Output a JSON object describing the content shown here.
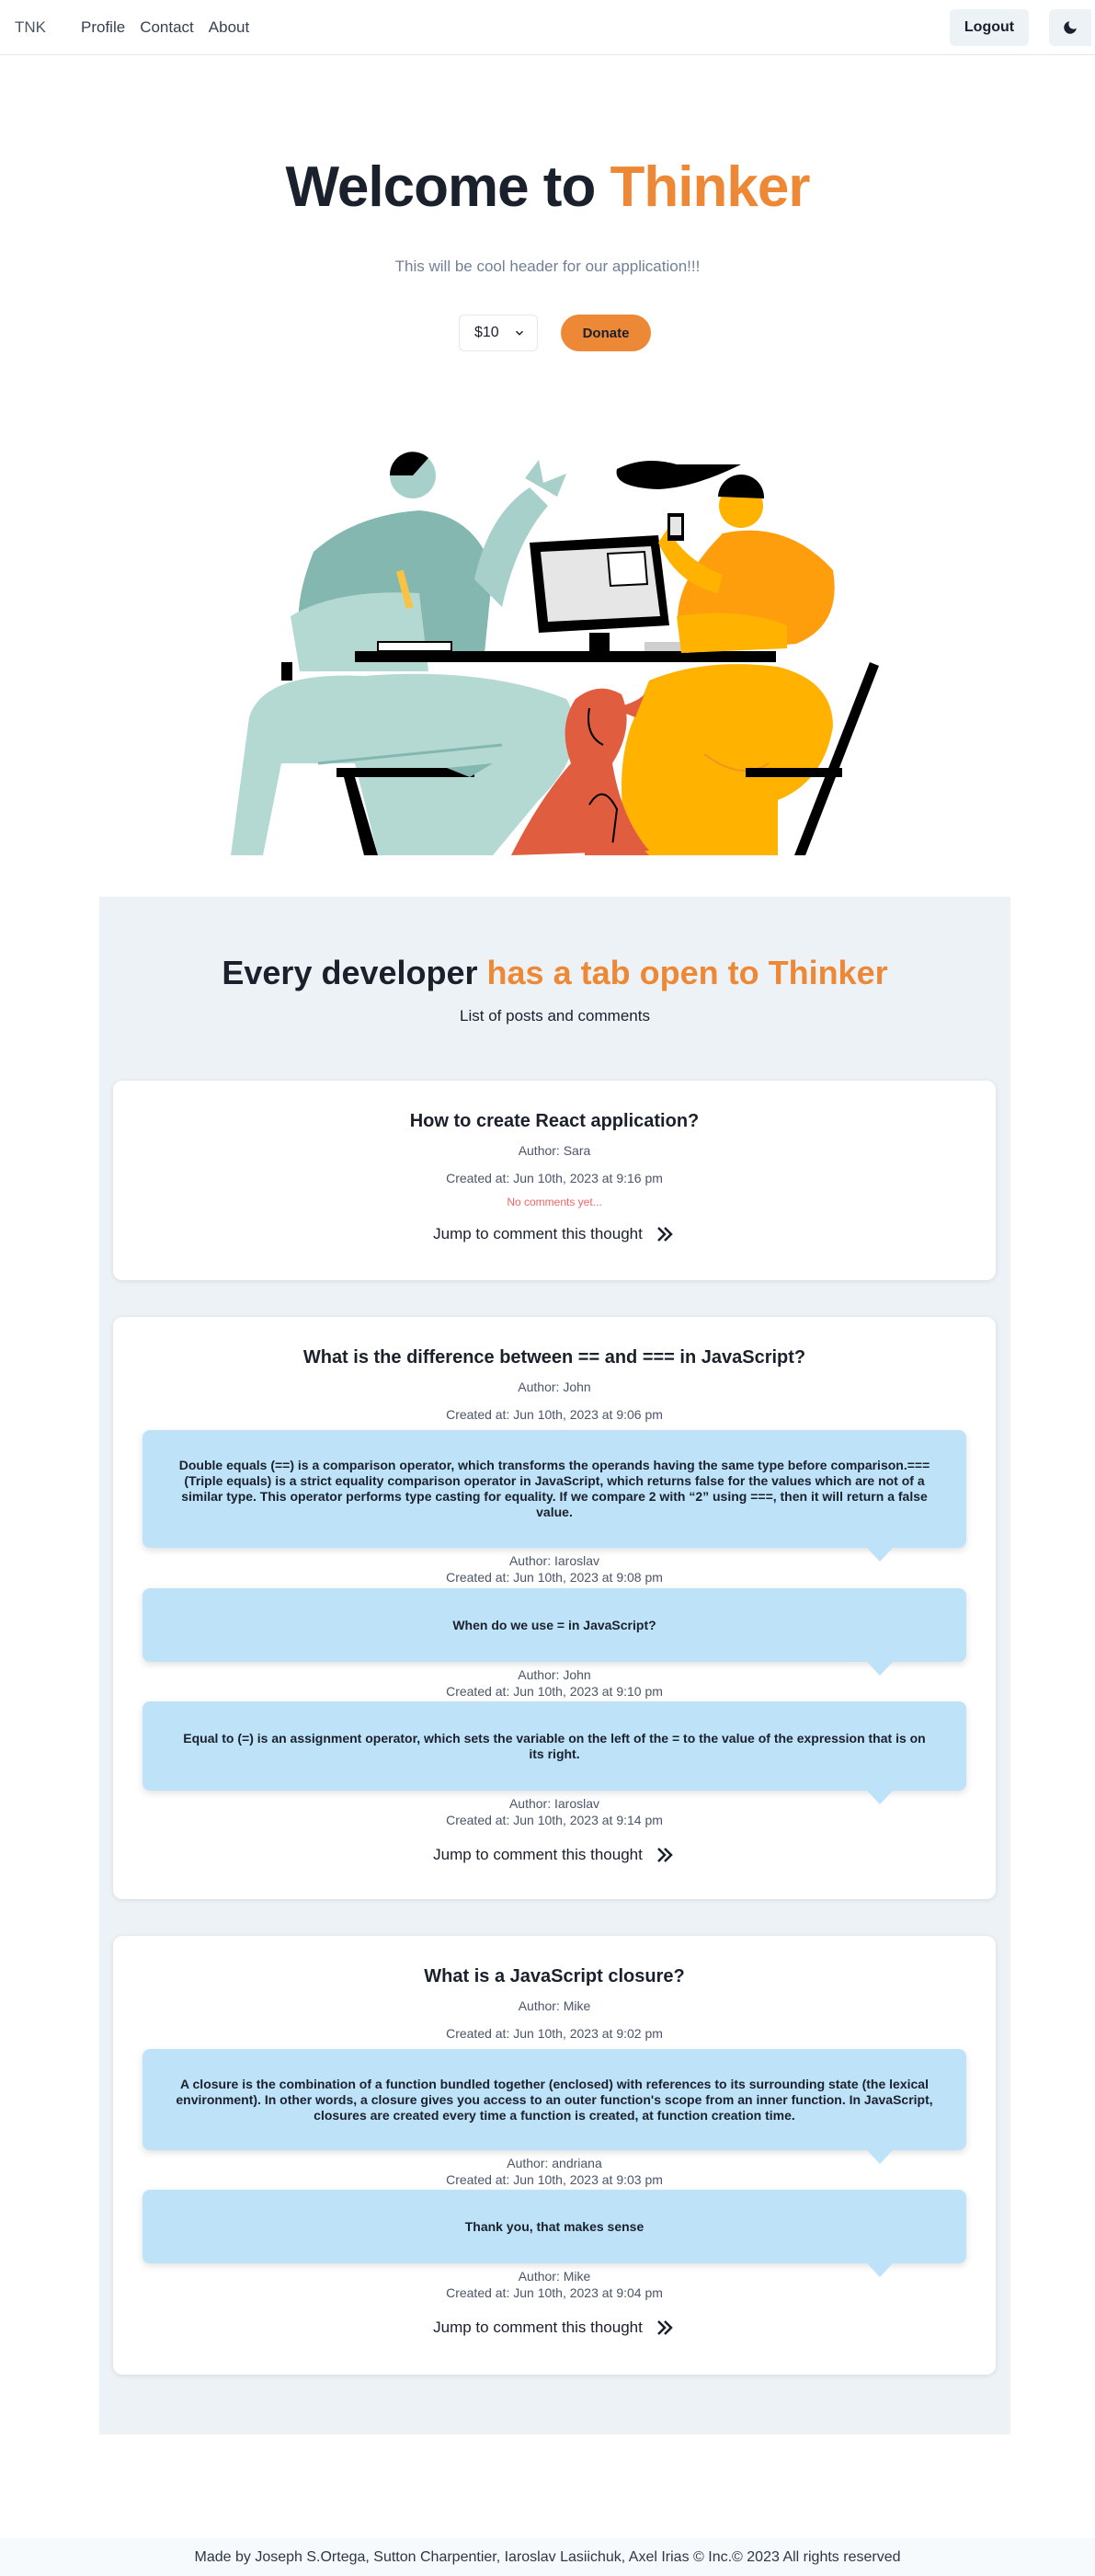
{
  "nav": {
    "brand": "TNK",
    "links": [
      "Profile",
      "Contact",
      "About"
    ],
    "logout": "Logout",
    "theme_icon": "moon-icon"
  },
  "hero": {
    "title_prefix": "Welcome to ",
    "title_accent": "Thinker",
    "subtitle": "This will be cool header for our application!!!",
    "amount": "$10",
    "donate": "Donate"
  },
  "section": {
    "title_prefix": "Every developer ",
    "title_accent": "has a tab open to Thinker",
    "subtitle": "List of posts and comments"
  },
  "posts": [
    {
      "title": "How to create React application?",
      "author": "Author: Sara",
      "created": "Created at: Jun 10th, 2023 at 9:16 pm",
      "no_comments": "No comments yet...",
      "jump": "Jump to comment this thought"
    },
    {
      "title": "What is the difference between == and === in JavaScript?",
      "author": "Author: John",
      "created": "Created at: Jun 10th, 2023 at 9:06 pm",
      "comments": [
        {
          "text": "Double equals (==) is a comparison operator, which transforms the operands having the same type before comparison.=== (Triple equals) is a strict equality comparison operator in JavaScript, which returns false for the values which are not of a similar type. This operator performs type casting for equality. If we compare 2 with “2” using ===, then it will return a false value.",
          "author": "Author: Iaroslav",
          "created": "Created at: Jun 10th, 2023 at 9:08 pm"
        },
        {
          "text": "When do we use = in JavaScript?",
          "author": "Author: John",
          "created": "Created at: Jun 10th, 2023 at 9:10 pm"
        },
        {
          "text": "Equal to (=) is an assignment operator, which sets the variable on the left of the = to the value of the expression that is on its right.",
          "author": "Author: Iaroslav",
          "created": "Created at: Jun 10th, 2023 at 9:14 pm"
        }
      ],
      "jump": "Jump to comment this thought"
    },
    {
      "title": "What is a JavaScript closure?",
      "author": "Author: Mike",
      "created": "Created at: Jun 10th, 2023 at 9:02 pm",
      "comments": [
        {
          "text": "A closure is the combination of a function bundled together (enclosed) with references to its surrounding state (the lexical environment). In other words, a closure gives you access to an outer function's scope from an inner function. In JavaScript, closures are created every time a function is created, at function creation time.",
          "author": "Author: andriana",
          "created": "Created at: Jun 10th, 2023 at 9:03 pm"
        },
        {
          "text": "Thank you, that makes sense",
          "author": "Author: Mike",
          "created": "Created at: Jun 10th, 2023 at 9:04 pm"
        }
      ],
      "jump": "Jump to comment this thought"
    }
  ],
  "footer": "Made by Joseph S.Ortega, Sutton Charpentier, Iaroslav Lasiichuk, Axel Irias © Inc.© 2023 All rights reserved",
  "colors": {
    "accent": "#ed8936",
    "bubble": "#bee3f8",
    "section_bg": "#edf2f7",
    "no_comments": "#f56565"
  }
}
